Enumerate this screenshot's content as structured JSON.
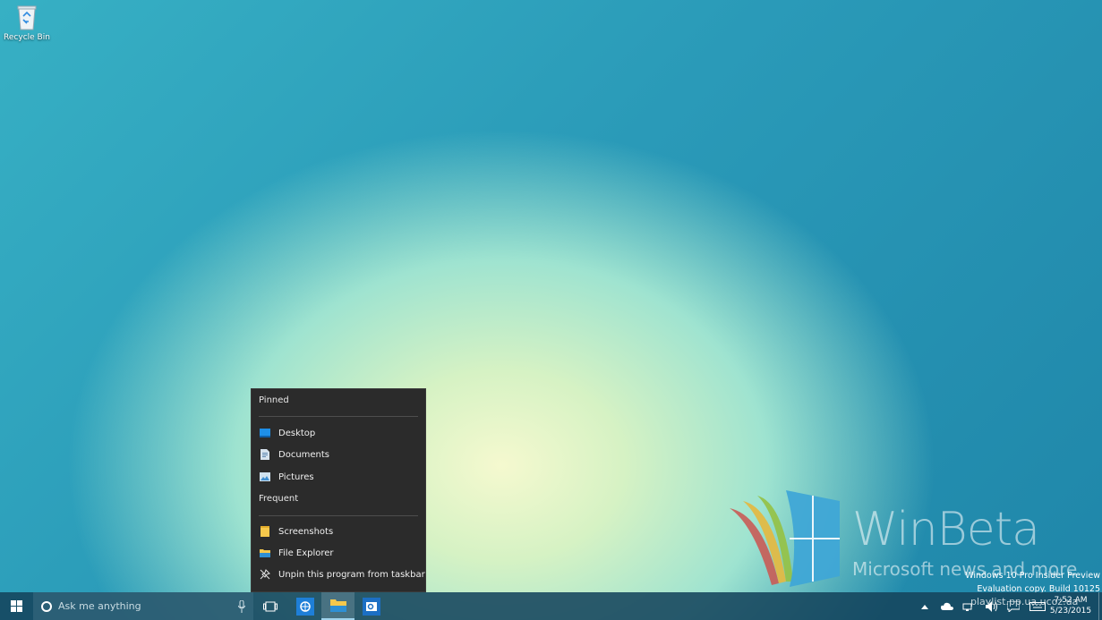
{
  "desktop": {
    "recycle_bin_label": "Recycle Bin"
  },
  "watermark": {
    "title": "WinBeta",
    "subtitle": "Microsoft news and more"
  },
  "evaluation": {
    "line1": "Windows 10 Pro Insider Preview",
    "line2": "Evaluation copy. Build 10125"
  },
  "jumplist": {
    "pinned_header": "Pinned",
    "pinned_items": [
      {
        "label": "Desktop",
        "icon": "desktop-icon"
      },
      {
        "label": "Documents",
        "icon": "documents-icon"
      },
      {
        "label": "Pictures",
        "icon": "pictures-icon"
      }
    ],
    "frequent_header": "Frequent",
    "frequent_items": [
      {
        "label": "Screenshots",
        "icon": "folder-icon"
      },
      {
        "label": "File Explorer",
        "icon": "file-explorer-icon"
      },
      {
        "label": "Unpin this program from taskbar",
        "icon": "unpin-icon"
      }
    ]
  },
  "taskbar": {
    "search_placeholder": "Ask me anything",
    "apps": [
      "task-view",
      "internet-explorer",
      "file-explorer",
      "outlook"
    ],
    "active_app": "file-explorer",
    "tray_overlay_text": "playlist.pp.ua.ucoz.ua",
    "time": "7:52 AM",
    "date": "5/23/2015"
  },
  "colors": {
    "taskbar": "#14445c",
    "jumplist_bg": "#2b2b2b",
    "accent_blue": "#1e90ff",
    "folder_yellow": "#f6c84c"
  }
}
